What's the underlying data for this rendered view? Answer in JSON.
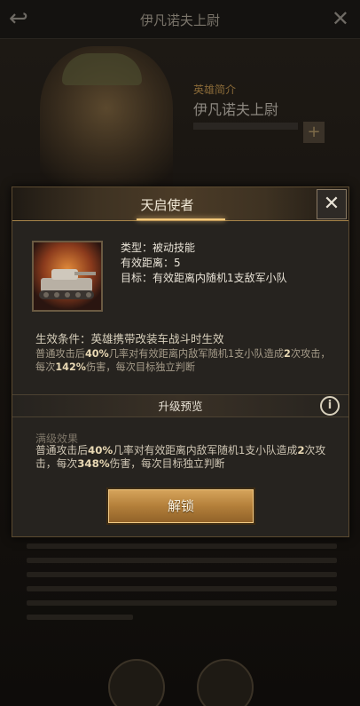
{
  "background": {
    "title": "伊凡诺夫上尉",
    "subtitle": "英雄简介",
    "hero_name": "伊凡诺夫上尉"
  },
  "modal": {
    "title": "天启使者",
    "type_line": "类型：被动技能",
    "range_line": "有效距离：5",
    "target_line": "目标：有效距离内随机1支敌军小队",
    "condition": "生效条件：英雄携带改装车战斗时生效",
    "desc_parts": [
      "普通攻击后",
      "40%",
      "几率对有效距离内敌军随机1支小队造成",
      "2",
      "次攻击，每次",
      "142%",
      "伤害，每次目标独立判断"
    ],
    "upgrade_label": "升级预览",
    "max_title": "满级效果",
    "max_parts": [
      "普通攻击后",
      "40%",
      "几率对有效距离内敌军随机1支小队造成",
      "2",
      "次攻击，每次",
      "348%",
      "伤害，每次目标独立判断"
    ],
    "unlock_label": "解锁"
  },
  "icons": {
    "close": "close-icon",
    "info": "info-icon",
    "skill": "tank-icon"
  },
  "colors": {
    "accent_gold": "#c8944a",
    "header_glow": "#f3c87a"
  }
}
